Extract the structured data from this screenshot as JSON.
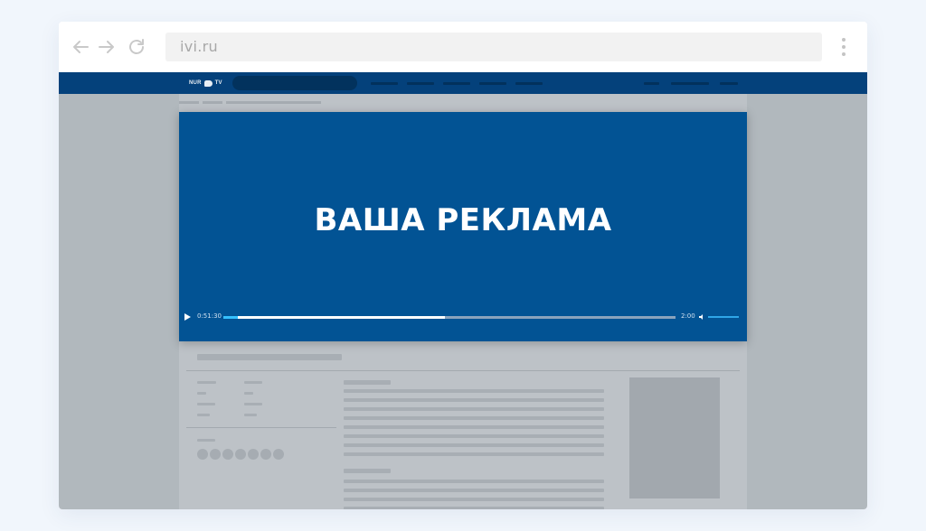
{
  "browser": {
    "url": "ivi.ru",
    "back_icon": "arrow-left-icon",
    "forward_icon": "arrow-right-icon",
    "reload_icon": "reload-icon",
    "menu_icon": "more-vertical-icon"
  },
  "site": {
    "logo_left": "NUR",
    "logo_right": "TV",
    "header_color": "#04417b"
  },
  "player": {
    "ad_text": "ВАША РЕКЛАМА",
    "current_time": "0:51:30",
    "duration": "2:00",
    "progress_fraction": 0.49,
    "ad_progress_fraction": 0.032,
    "background_color": "#025394",
    "accent_color": "#35c0ff",
    "volume_icon": "volume-icon"
  }
}
